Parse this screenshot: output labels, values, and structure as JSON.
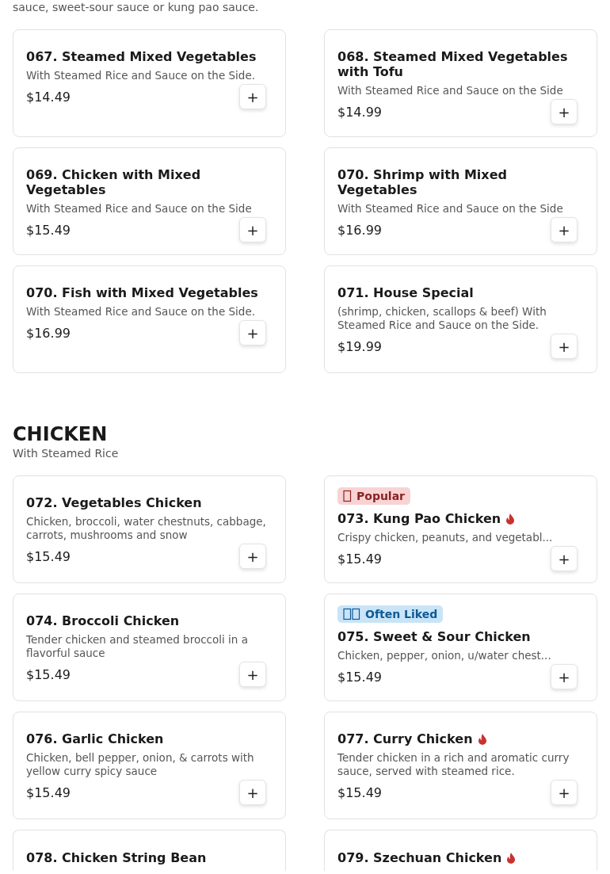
{
  "sections": [
    {
      "description": "sauce, sweet-sour sauce or kung pao sauce.",
      "items": [
        {
          "name": "067. Steamed Mixed Vegetables",
          "description": "With Steamed Rice and Sauce on the Side.",
          "price": "$14.49",
          "spicy": false,
          "add_button": "+"
        },
        {
          "name": "068. Steamed Mixed Vegetables with Tofu",
          "description": "With Steamed Rice and Sauce on the Side",
          "price": "$14.99",
          "spicy": false,
          "add_button": "+"
        },
        {
          "name": "069. Chicken with Mixed Vegetables",
          "description": "With Steamed Rice and Sauce on the Side",
          "price": "$15.49",
          "spicy": false,
          "add_button": "+"
        },
        {
          "name": "070. Shrimp with Mixed Vegetables",
          "description": "With Steamed Rice and Sauce on the Side",
          "price": "$16.99",
          "spicy": false,
          "add_button": "+"
        },
        {
          "name": "070. Fish with Mixed Vegetables",
          "description": "With Steamed Rice and Sauce on the Side.",
          "price": "$16.99",
          "spicy": false,
          "add_button": "+"
        },
        {
          "name": "071. House Special",
          "description": "(shrimp, chicken, scallops & beef) With Steamed Rice and Sauce on the Side.",
          "price": "$19.99",
          "spicy": false,
          "add_button": "+"
        }
      ]
    },
    {
      "title": "CHICKEN",
      "description": "With Steamed Rice",
      "items": [
        {
          "name": "072. Vegetables Chicken",
          "description": "Chicken, broccoli, water chestnuts, cabbage, carrots, mushrooms and snow",
          "price": "$15.49",
          "spicy": false,
          "add_button": "+"
        },
        {
          "badge": {
            "kind": "popular",
            "label": "Popular"
          },
          "name": "073. Kung Pao Chicken",
          "description": "Crispy chicken, peanuts, and vegetabl...",
          "price": "$15.49",
          "spicy": true,
          "add_button": "+"
        },
        {
          "name": "074. Broccoli Chicken",
          "description": "Tender chicken and steamed broccoli in a flavorful sauce",
          "price": "$15.49",
          "spicy": false,
          "add_button": "+"
        },
        {
          "badge": {
            "kind": "liked",
            "label": "Often Liked"
          },
          "name": "075. Sweet & Sour Chicken",
          "description": "Chicken, pepper, onion, u/water chest...",
          "price": "$15.49",
          "spicy": false,
          "add_button": "+"
        },
        {
          "name": "076. Garlic Chicken",
          "description": "Chicken, bell pepper, onion, & carrots with yellow curry spicy sauce",
          "price": "$15.49",
          "spicy": false,
          "add_button": "+"
        },
        {
          "name": "077. Curry Chicken",
          "description": "Tender chicken in a rich and aromatic curry sauce, served with steamed rice.",
          "price": "$15.49",
          "spicy": true,
          "add_button": "+"
        },
        {
          "name": "078. Chicken String Bean",
          "spicy": false
        },
        {
          "name": "079. Szechuan Chicken",
          "spicy": true
        }
      ]
    }
  ]
}
